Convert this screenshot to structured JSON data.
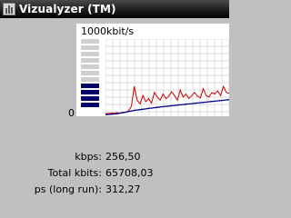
{
  "window": {
    "title": "Vizualyzer (TM)"
  },
  "chart": {
    "scale_label": "1000kbit/s",
    "zero_label": "0"
  },
  "vu_meter": {
    "segments_total": 11,
    "segments_lit": 4
  },
  "chart_data": {
    "type": "line",
    "ylim": [
      0,
      1000
    ],
    "series": [
      {
        "color": "#cc0000",
        "values": [
          20,
          25,
          30,
          28,
          35,
          30,
          40,
          38,
          60,
          120,
          380,
          200,
          150,
          260,
          180,
          220,
          160,
          300,
          240,
          200,
          280,
          220,
          250,
          310,
          260,
          200,
          330,
          240,
          280,
          220,
          260,
          300,
          250,
          230,
          350,
          260,
          240,
          300,
          280,
          320,
          260,
          380,
          300,
          290
        ]
      },
      {
        "color": "#00008b",
        "values": [
          10,
          12,
          14,
          18,
          22,
          28,
          35,
          42,
          50,
          58,
          65,
          70,
          75,
          80,
          85,
          90,
          95,
          100,
          105,
          110,
          114,
          118,
          122,
          126,
          130,
          134,
          138,
          142,
          146,
          150,
          154,
          158,
          162,
          166,
          170,
          174,
          178,
          182,
          186,
          190,
          194,
          198,
          202,
          206
        ]
      }
    ],
    "gridlines": true
  },
  "stats": [
    {
      "label": "kbps:",
      "value": "256,50"
    },
    {
      "label": "Total kbits:",
      "value": "65708,03"
    },
    {
      "label": "ps (long run):",
      "value": "312,27"
    }
  ]
}
